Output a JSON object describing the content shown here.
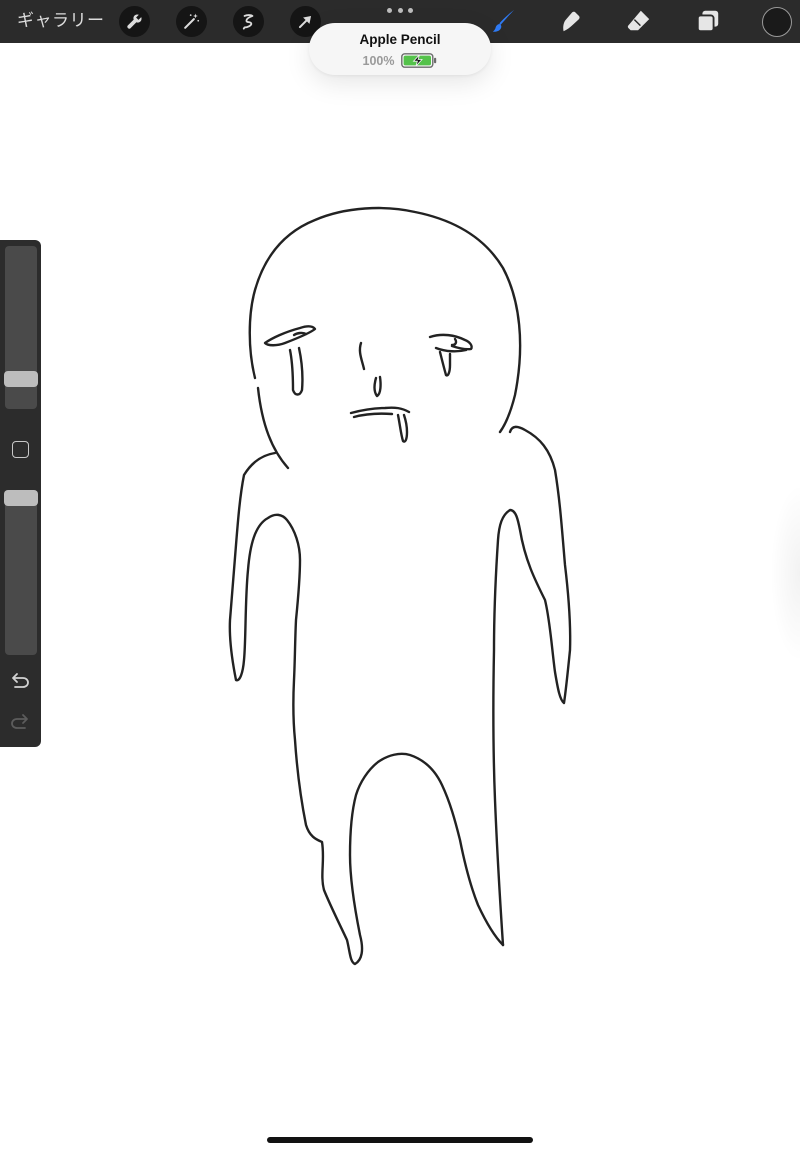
{
  "toolbar": {
    "gallery_label": "ギャラリー",
    "left_tools": [
      "wrench-icon",
      "magic-wand-icon",
      "selection-icon",
      "transform-arrow-icon"
    ],
    "right_tools": [
      "brush-icon",
      "smudge-icon",
      "eraser-icon",
      "layers-icon"
    ],
    "active_tool": "brush",
    "accent_color": "#2f7bf5",
    "current_color": "#1a1a1a"
  },
  "pencil_popup": {
    "device_name": "Apple Pencil",
    "battery_percent": "100%",
    "battery_level": 1.0,
    "charging": true
  },
  "sidebar": {
    "brush_size_level": 0.15,
    "brush_opacity_level": 1.0,
    "modify_button": "square-icon",
    "undo": "undo-icon",
    "redo": "redo-icon"
  },
  "canvas": {
    "background": "#ffffff",
    "stroke_color": "#222222",
    "subject": "sketch-figure"
  }
}
